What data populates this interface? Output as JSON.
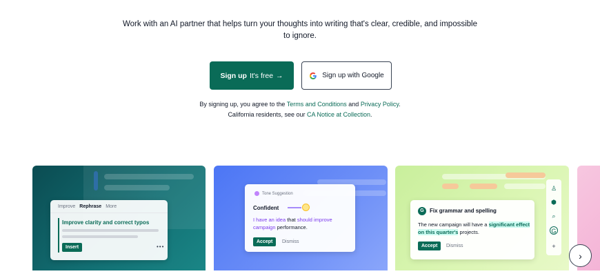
{
  "hero": {
    "subtitle_line1": "Work with an AI partner that helps turn your thoughts into writing that's clear, credible, and impossible",
    "subtitle_line2": "to ignore."
  },
  "cta": {
    "signup_bold": "Sign up",
    "signup_rest": "It's free",
    "signup_arrow": "→",
    "google_label": "Sign up with Google",
    "google_icon": "google-g-icon"
  },
  "legal": {
    "prefix": "By signing up, you agree to the ",
    "terms": "Terms and Conditions",
    "and": " and ",
    "privacy": "Privacy Policy",
    "period": ".",
    "line2_prefix": "California residents, see our ",
    "ca_notice": "CA Notice at Collection",
    "line2_suffix": "."
  },
  "cards": {
    "rewrite": {
      "tab_improve": "Improve",
      "tab_rephrase": "Rephrase",
      "tab_more": "More",
      "title": "Improve clarity and correct typos",
      "insert": "Insert",
      "more_dots": "•••"
    },
    "tone": {
      "label": "Tone Suggestion",
      "tone": "Confident",
      "text_pre": "",
      "hl1": "I have an idea",
      "mid1": " that ",
      "hl2": "should improve campaign",
      "post": " performance.",
      "accept": "Accept",
      "dismiss": "Dismiss"
    },
    "grammar": {
      "title": "Fix grammar and spelling",
      "text_pre": "The new campaign will have a ",
      "hl": "significant effect on this quarter's",
      "post": " projects.",
      "accept": "Accept",
      "dismiss": "Dismiss"
    }
  },
  "carousel": {
    "next_icon": "chevron-right-icon",
    "next_glyph": "›"
  },
  "colors": {
    "brand": "#0a6b57",
    "card1": "#126e72",
    "card2": "#5b80f6",
    "card3": "#d4f3a9",
    "card4": "#f5bcd9"
  }
}
